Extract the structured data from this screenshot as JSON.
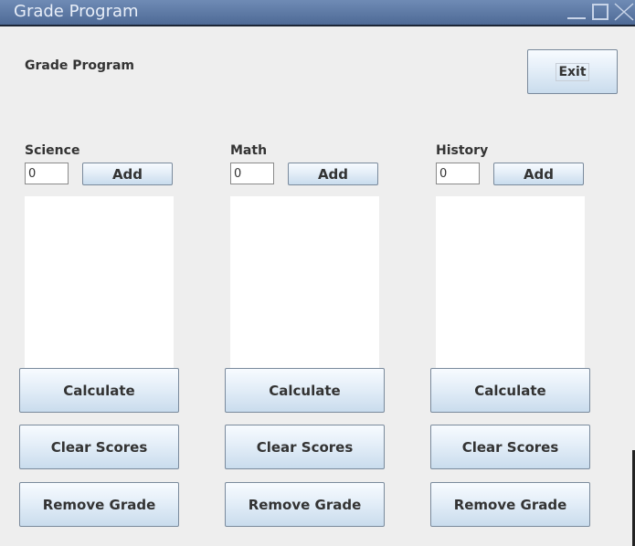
{
  "window": {
    "title": "Grade Program"
  },
  "header": {
    "label": "Grade Program",
    "exit_label": "Exit"
  },
  "subjects": [
    {
      "name": "Science",
      "input_value": "0",
      "add_label": "Add",
      "calculate_label": "Calculate",
      "clear_label": "Clear Scores",
      "remove_label": "Remove Grade"
    },
    {
      "name": "Math",
      "input_value": "0",
      "add_label": "Add",
      "calculate_label": "Calculate",
      "clear_label": "Clear Scores",
      "remove_label": "Remove Grade"
    },
    {
      "name": "History",
      "input_value": "0",
      "add_label": "Add",
      "calculate_label": "Calculate",
      "clear_label": "Clear Scores",
      "remove_label": "Remove Grade"
    }
  ]
}
